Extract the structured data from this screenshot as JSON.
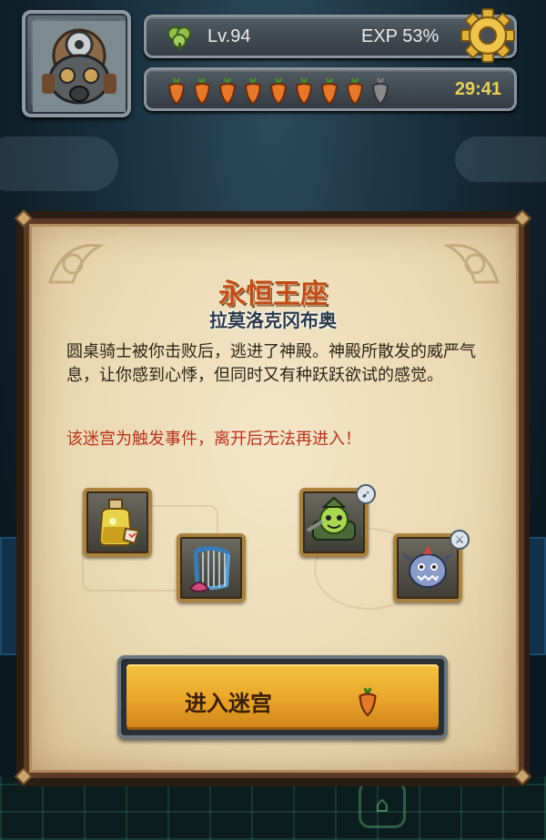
{
  "hud": {
    "level": "Lv.94",
    "exp": "EXP 53%",
    "stamina_total": 9,
    "stamina_filled": 8,
    "timer": "29:41"
  },
  "dialog": {
    "title": "永恒王座",
    "subtitle": "拉莫洛克冈布奥",
    "description": "圆桌骑士被你击败后，逃进了神殿。神殿所散发的威严气息，让你感到心悸，但同时又有种跃跃欲试的感觉。",
    "warning": "该迷宫为触发事件，离开后无法再进入！",
    "enter_button": "进入迷宫"
  },
  "rewards": [
    {
      "icon": "potion-icon"
    },
    {
      "icon": "harp-icon"
    },
    {
      "icon": "goblin-warrior-icon",
      "badge": "compass-badge"
    },
    {
      "icon": "shark-monster-icon",
      "badge": "sword-badge"
    }
  ],
  "colors": {
    "title": "#c04a18",
    "warning": "#b8321c",
    "button": "#e9a42a",
    "timer": "#e8d05a"
  }
}
